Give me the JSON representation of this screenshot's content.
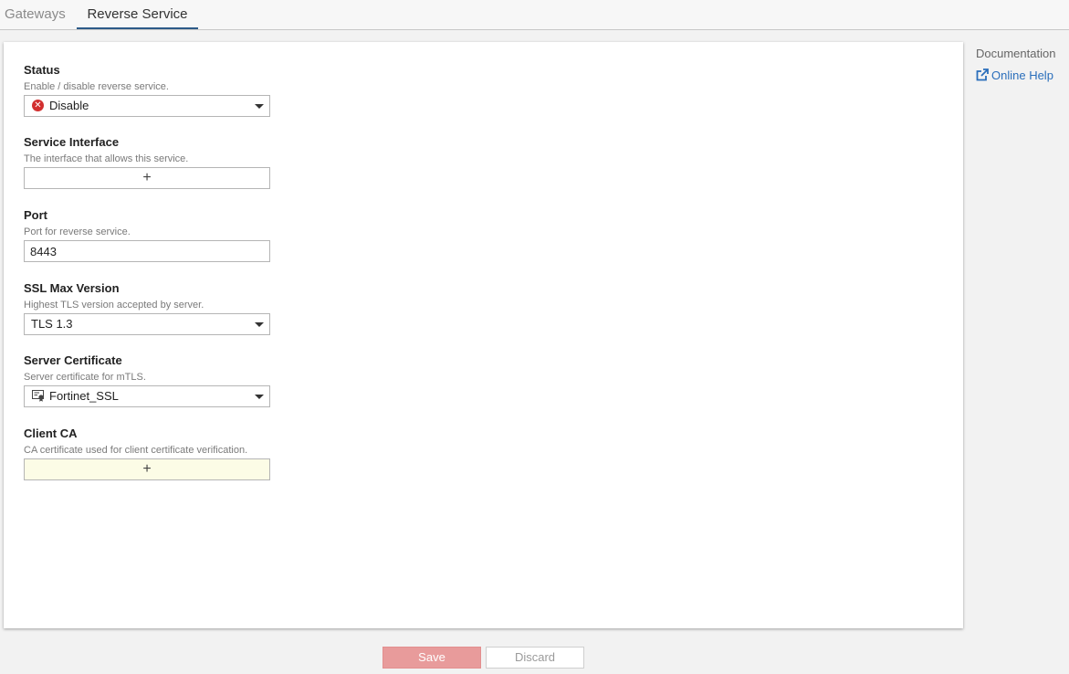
{
  "tabs": [
    {
      "label": "Gateways"
    },
    {
      "label": "Reverse Service"
    }
  ],
  "form": {
    "status": {
      "label": "Status",
      "hint": "Enable / disable reverse service.",
      "value": "Disable",
      "icon": "x-circle-icon",
      "icon_color": "#d22f2f"
    },
    "service_interface": {
      "label": "Service Interface",
      "hint": "The interface that allows this service.",
      "add_symbol": "+"
    },
    "port": {
      "label": "Port",
      "hint": "Port for reverse service.",
      "value": "8443"
    },
    "ssl_max_version": {
      "label": "SSL Max Version",
      "hint": "Highest TLS version accepted by server.",
      "value": "TLS 1.3"
    },
    "server_certificate": {
      "label": "Server Certificate",
      "hint": "Server certificate for mTLS.",
      "value": "Fortinet_SSL",
      "icon": "certificate-icon"
    },
    "client_ca": {
      "label": "Client CA",
      "hint": "CA certificate used for client certificate verification.",
      "add_symbol": "+"
    }
  },
  "documentation": {
    "title": "Documentation",
    "online_help": "Online Help",
    "link_color": "#2a6ebb"
  },
  "buttons": {
    "save": "Save",
    "discard": "Discard"
  },
  "colors": {
    "accent": "#2d5b88",
    "save_button": "#e89b9b"
  }
}
